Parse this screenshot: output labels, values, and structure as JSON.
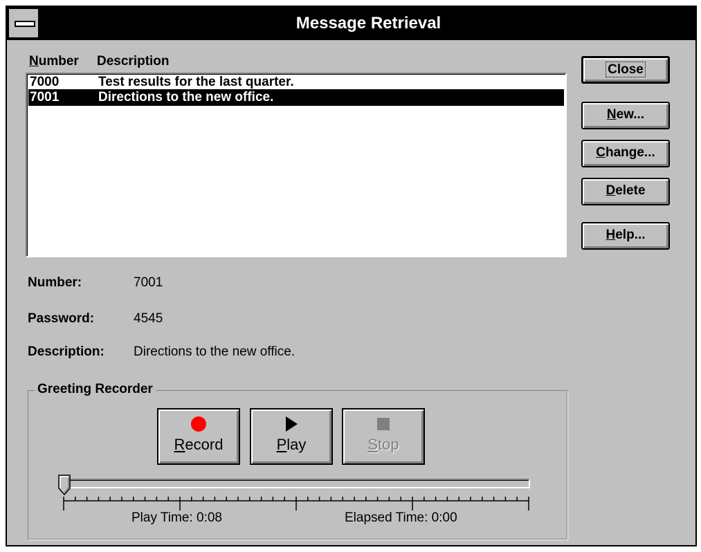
{
  "window": {
    "title": "Message Retrieval"
  },
  "list": {
    "header_number": "Number",
    "header_description": "Description",
    "rows": [
      {
        "number": "7000",
        "description": "Test results for the last quarter.",
        "selected": false
      },
      {
        "number": "7001",
        "description": "Directions to the new office.",
        "selected": true
      }
    ]
  },
  "buttons": {
    "close": "Close",
    "new": "New...",
    "change": "Change...",
    "delete": "Delete",
    "help": "Help..."
  },
  "details": {
    "number_label": "Number:",
    "number_value": "7001",
    "password_label": "Password:",
    "password_value": "4545",
    "description_label": "Description:",
    "description_value": "Directions to the new office."
  },
  "recorder": {
    "group_title": "Greeting Recorder",
    "record_label": "Record",
    "play_label": "Play",
    "stop_label": "Stop",
    "stop_enabled": false,
    "record_icon": "red-circle-icon",
    "play_icon": "play-triangle-icon",
    "stop_icon": "stop-square-icon",
    "play_time": "Play Time: 0:08",
    "elapsed_time": "Elapsed Time: 0:00",
    "position_fraction": 0.0
  },
  "colors": {
    "record_dot": "#ff0000",
    "selection": "#000000",
    "face": "#c0c0c0"
  }
}
